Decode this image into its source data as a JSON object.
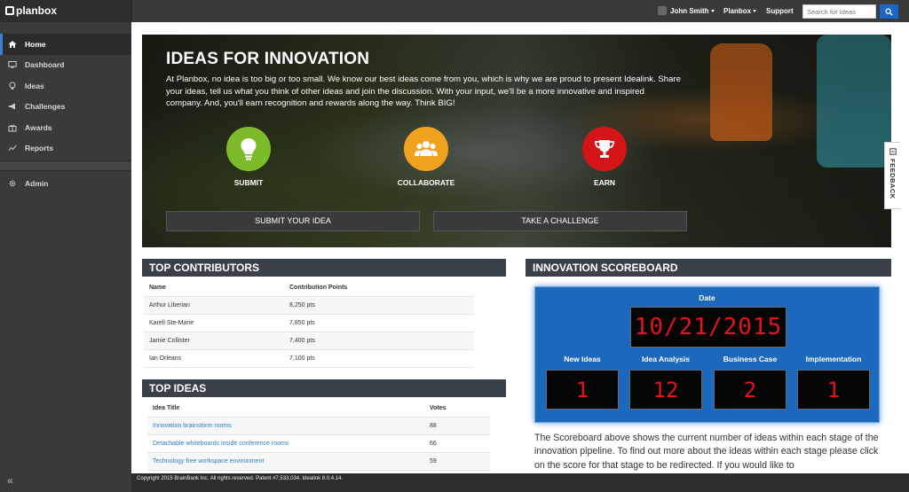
{
  "brand": {
    "name": "planbox"
  },
  "sidebar": {
    "items": [
      {
        "label": "Home",
        "icon": "home-icon",
        "active": true
      },
      {
        "label": "Dashboard",
        "icon": "monitor-icon"
      },
      {
        "label": "Ideas",
        "icon": "lightbulb-icon"
      },
      {
        "label": "Challenges",
        "icon": "megaphone-icon"
      },
      {
        "label": "Awards",
        "icon": "gift-icon"
      },
      {
        "label": "Reports",
        "icon": "chart-line-icon"
      }
    ],
    "admin": {
      "label": "Admin",
      "icon": "gear-icon"
    },
    "collapse_glyph": "«"
  },
  "topbar": {
    "user": "John Smith",
    "menu": "Planbox",
    "support": "Support",
    "search_placeholder": "Search for Ideas"
  },
  "hero": {
    "title": "IDEAS FOR INNOVATION",
    "text": "At Planbox, no idea is too big or too small. We know our best ideas come from you, which is why we are proud to present Idealink. Share your ideas, tell us what you think of other ideas and join the discussion. With your input, we'll be a more innovative and inspired company. And, you'll earn recognition and rewards along the way. Think BIG!",
    "actions": [
      {
        "label": "SUBMIT",
        "icon": "lightbulb-icon",
        "color": "#7dbb2b"
      },
      {
        "label": "COLLABORATE",
        "icon": "people-icon",
        "color": "#f0a21e"
      },
      {
        "label": "EARN",
        "icon": "trophy-icon",
        "color": "#d41417"
      }
    ],
    "buttons": {
      "submit": "SUBMIT YOUR IDEA",
      "challenge": "TAKE A CHALLENGE"
    }
  },
  "feedback": {
    "label": "FEEDBACK"
  },
  "contributors": {
    "title": "TOP CONTRIBUTORS",
    "headers": {
      "name": "Name",
      "points": "Contribution Points"
    },
    "rows": [
      {
        "name": "Arthur Liberian",
        "points": "8,250 pts"
      },
      {
        "name": "Karell Ste-Marie",
        "points": "7,850 pts"
      },
      {
        "name": "Jamie Collister",
        "points": "7,400 pts"
      },
      {
        "name": "Ian Orleans",
        "points": "7,100 pts"
      }
    ]
  },
  "ideas": {
    "title": "TOP IDEAS",
    "headers": {
      "title": "Idea Title",
      "votes": "Votes"
    },
    "rows": [
      {
        "title": "Innovation brainstorm rooms",
        "votes": "88"
      },
      {
        "title": "Detachable whiteboards inside conference rooms",
        "votes": "66"
      },
      {
        "title": "Technology free workspace environment",
        "votes": "59"
      }
    ]
  },
  "scoreboard": {
    "title": "INNOVATION SCOREBOARD",
    "date_label": "Date",
    "date": "10/21/2015",
    "stages": [
      {
        "label": "New Ideas",
        "value": "1"
      },
      {
        "label": "Idea Analysis",
        "value": "12"
      },
      {
        "label": "Business Case",
        "value": "2"
      },
      {
        "label": "Implementation",
        "value": "1"
      }
    ],
    "description": "The Scoreboard above shows the current number of ideas within each stage of the innovation pipeline. To find out more about the ideas within each stage please click on the score for that stage to be redirected. If you would like to"
  },
  "footer": {
    "text": "Copyright 2015 BrainBank Inc. All rights reserved. Patent #7,533,034. Idealink 8.0.4.14."
  }
}
